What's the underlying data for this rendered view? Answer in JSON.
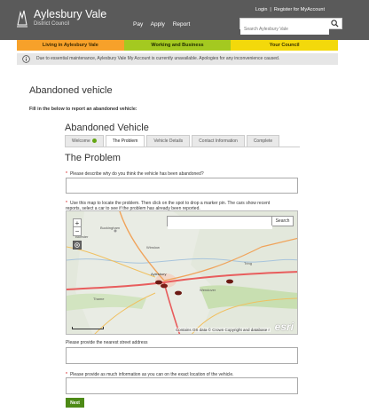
{
  "header": {
    "logo_name": "Aylesbury Vale",
    "logo_sub": "District Council",
    "nav": [
      "Pay",
      "Apply",
      "Report"
    ],
    "login": "Login",
    "register": "Register for MyAccount",
    "search_placeholder": "Search Aylesbury Vale"
  },
  "colour_nav": [
    "Living in Aylesbury Vale",
    "Working and Business",
    "Your Council"
  ],
  "notice": "Due to essential maintenance, Aylesbury Vale My Account is currently unavailable. Apologies for any inconvenience caused.",
  "page_title": "Abandoned vehicle",
  "intro": "Fill in the below to report an abandoned vehicle:",
  "form_title": "Abandoned Vehicle",
  "tabs": [
    {
      "label": "Welcome",
      "done": true
    },
    {
      "label": "The Problem",
      "active": true
    },
    {
      "label": "Vehicle Details"
    },
    {
      "label": "Contact Information"
    },
    {
      "label": "Complete"
    }
  ],
  "section_title": "The Problem",
  "q1": "Please describe why do you think the vehicle has been abandoned?",
  "q2_line1": "Use this map to locate the problem. Then click on the spot to drop a marker pin. The cars show recent",
  "q2_line2": "reports, select a car to see if the problem has already been reported.",
  "map": {
    "search_button": "Search",
    "attribution": "Contains OS data © Crown Copyright and database r",
    "logo": "esri",
    "places": [
      "Buckingham",
      "Winslow",
      "Aylesbury",
      "Thame",
      "Wendover",
      "Tring",
      "Bicester"
    ]
  },
  "q3": "Please provide the nearest street address",
  "q4": "Please provide as much information as you can on the exact location of the vehicle.",
  "next_label": "Next",
  "colors": {
    "header": "#5a5a5a",
    "living": "#f7a12a",
    "working": "#a4c920",
    "council": "#f3d90b",
    "button": "#4d8a16"
  }
}
